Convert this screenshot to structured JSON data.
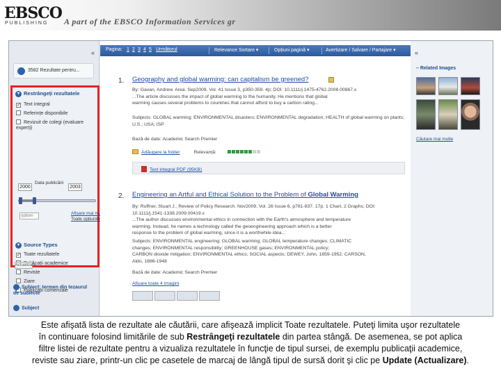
{
  "banner": {
    "logo_text": "EBSCO",
    "logo_sub": "PUBLISHING",
    "tagline": "A part of the EBSCO Information Services gr"
  },
  "sidebar": {
    "collapse_icon": "«",
    "result_label": "3582 Rezultate pentru...",
    "refine": {
      "title": "Restrângeți rezultatele",
      "limiters": [
        {
          "label": "Text integral",
          "checked": true
        },
        {
          "label": "Referințe disponibile",
          "checked": false
        },
        {
          "label": "Revizuit de colegi (evaluare experți)",
          "checked": false
        }
      ],
      "date_label": "Data publicării",
      "date_from": "2000",
      "date_to": "2003",
      "date_placeholder": "opțiuni",
      "show_more": "Afișare mai mult ▸",
      "show_more_sub": "Toate opțiunile",
      "source_types_title": "Source Types",
      "source_types": [
        {
          "label": "Toate rezultatele",
          "checked": true
        },
        {
          "label": "Publicații academice",
          "checked": false
        },
        {
          "label": "Reviste",
          "checked": false
        },
        {
          "label": "Ziare",
          "checked": false
        },
        {
          "label": "Publicații comerciale",
          "checked": false
        }
      ],
      "update_button": "Actualizare"
    },
    "subject_thesaurus": "Subiect: termen din tezaurul de subiecte",
    "subject": "Subject"
  },
  "toolbar": {
    "pages_label": "Pagina:",
    "pages": [
      "1",
      "2",
      "3",
      "4",
      "5"
    ],
    "next": "Următorul",
    "sort": "Relevance Sortare ▾",
    "page_options": "Opțiuni pagină ▾",
    "alert": "Avertizare / Salvare / Partajare ▾"
  },
  "results": [
    {
      "number": "1.",
      "title": "Geography and global warming: can capitalism be greened?",
      "lines": [
        "By: Gavan, Andrew. Area. Sep2009, Vol. 41 Issue 3, p350-359. 4p; DOI: 10.1111/j.1475-4762.2008.00867.x",
        "...The article discusses the impact of global warming to the humanity. He mentions that global",
        "warming causes several problems to countries that cannot afford to buy a carbon rating..."
      ],
      "subjects": "Subjects: GLOBAL warming; ENVIRONMENTAL disasters; ENVIRONMENTAL degradation; HEALTH of global warming on plants; U.S.; USA; ISP",
      "database": "Bază de date: Academic Search Premier",
      "folder_link": "Adăugare la folder",
      "relevance": "Relevanță:",
      "relevance_level": 6,
      "relevance_max": 8,
      "pdf_link": "Text integral PDF (95KB)"
    },
    {
      "number": "2.",
      "title_pre": "Engineering an Artful and Ethical Solution to the Problem of ",
      "title_bold": "Global Warming",
      "lines": [
        "By: Ruffner, Stuart J.. Review of Policy Research. Nov2009, Vol. 26 Issue 6, p781-837. 17p. 1 Chart, 2 Graphs; DOI:",
        "10.1111/j.1541-1338.2009.00419.x",
        "...The author discusses environmental ethics in connection with the Earth's atmosphere and temperature",
        "warming. Instead, he names a technology called the geoengineering approach which is a better",
        "response to the problem of global warming, since it is a worthwhile idea..."
      ],
      "subjects": [
        "Subjects: ENVIRONMENTAL engineering; GLOBAL warming; GLOBAL temperature changes; CLIMATIC",
        "changes; ENVIRONMENTAL responsibility; GREENHOUSE gases; ENVIRONMENTAL policy;",
        "CARBON dioxide mitigation; ENVIRONMENTAL ethics; SOCIAL aspects; DEWEY, John, 1859-1952; CARSON,",
        "Aldo, 1886-1948"
      ],
      "database": "Bază de date: Academic Search Premier",
      "images_link": "Afișare toate 4 imagini"
    }
  ],
  "right_panel": {
    "collapse_icon": "«",
    "related_images": "– Related Images",
    "search_more": "Căutare mai multe"
  },
  "caption": {
    "line1": "Este afişată lista de rezultate ale căutării, care afişează implicit Toate rezultatele. Puteţi limita uşor rezultatele",
    "line2_pre": "în continuare folosind limitările de sub ",
    "line2_bold": "Restrângeţi rezultatele",
    "line2_post": " din partea stângă. De asemenea, se pot aplica",
    "line3": "filtre listei de rezultate pentru a vizualiza rezultatele în funcţie de tipul sursei, de exemplu publicaţii academice,",
    "line4_pre": "reviste sau ziare, printr-un clic pe casetele de marcaj de lângă tipul de sursă dorit şi clic pe ",
    "line4_bold": "Update (Actualizare)",
    "line4_post": "."
  },
  "colors": {
    "highlight_box": "#e8211f",
    "toolbar": "#2c5a9c",
    "link": "#1f4d9e"
  }
}
